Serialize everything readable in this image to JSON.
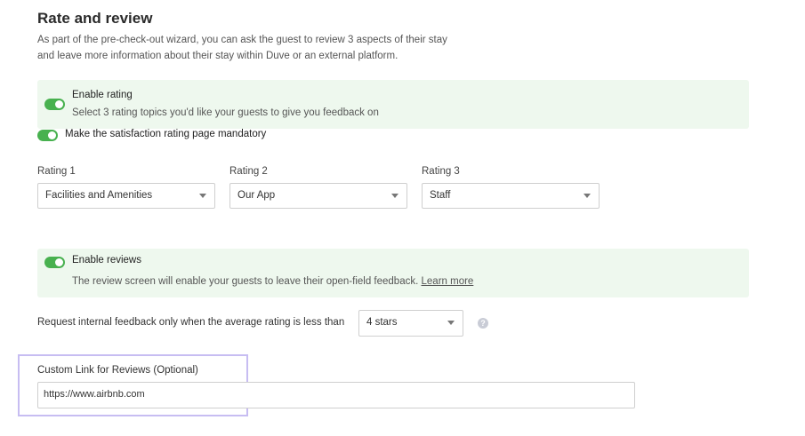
{
  "header": {
    "title": "Rate and review",
    "description_line1": "As part of the pre-check-out wizard, you can ask the guest to review 3 aspects of their stay",
    "description_line2": "and leave more information about their stay within Duve or an external platform."
  },
  "rating": {
    "enable_label": "Enable rating",
    "enable_sub": "Select 3 rating topics you'd like your guests to give you feedback on",
    "enabled": true,
    "mandatory_label": "Make the satisfaction rating page mandatory",
    "mandatory": true,
    "selects": [
      {
        "label": "Rating 1",
        "value": "Facilities and Amenities"
      },
      {
        "label": "Rating 2",
        "value": "Our App"
      },
      {
        "label": "Rating 3",
        "value": "Staff"
      }
    ]
  },
  "reviews": {
    "enable_label": "Enable reviews",
    "enabled": true,
    "sub_text": "The review screen will enable your guests to leave their open-field feedback.",
    "learn_more": "Learn more",
    "threshold_label": "Request internal feedback only when the average rating is less than",
    "threshold_value": "4 stars",
    "help_glyph": "?",
    "custom_link_label": "Custom Link for Reviews (Optional)",
    "custom_link_value": "https://www.airbnb.com"
  },
  "colors": {
    "toggle_on": "#48b14f",
    "panel_bg": "#eef8ee",
    "highlight": "#c7bdf2"
  }
}
